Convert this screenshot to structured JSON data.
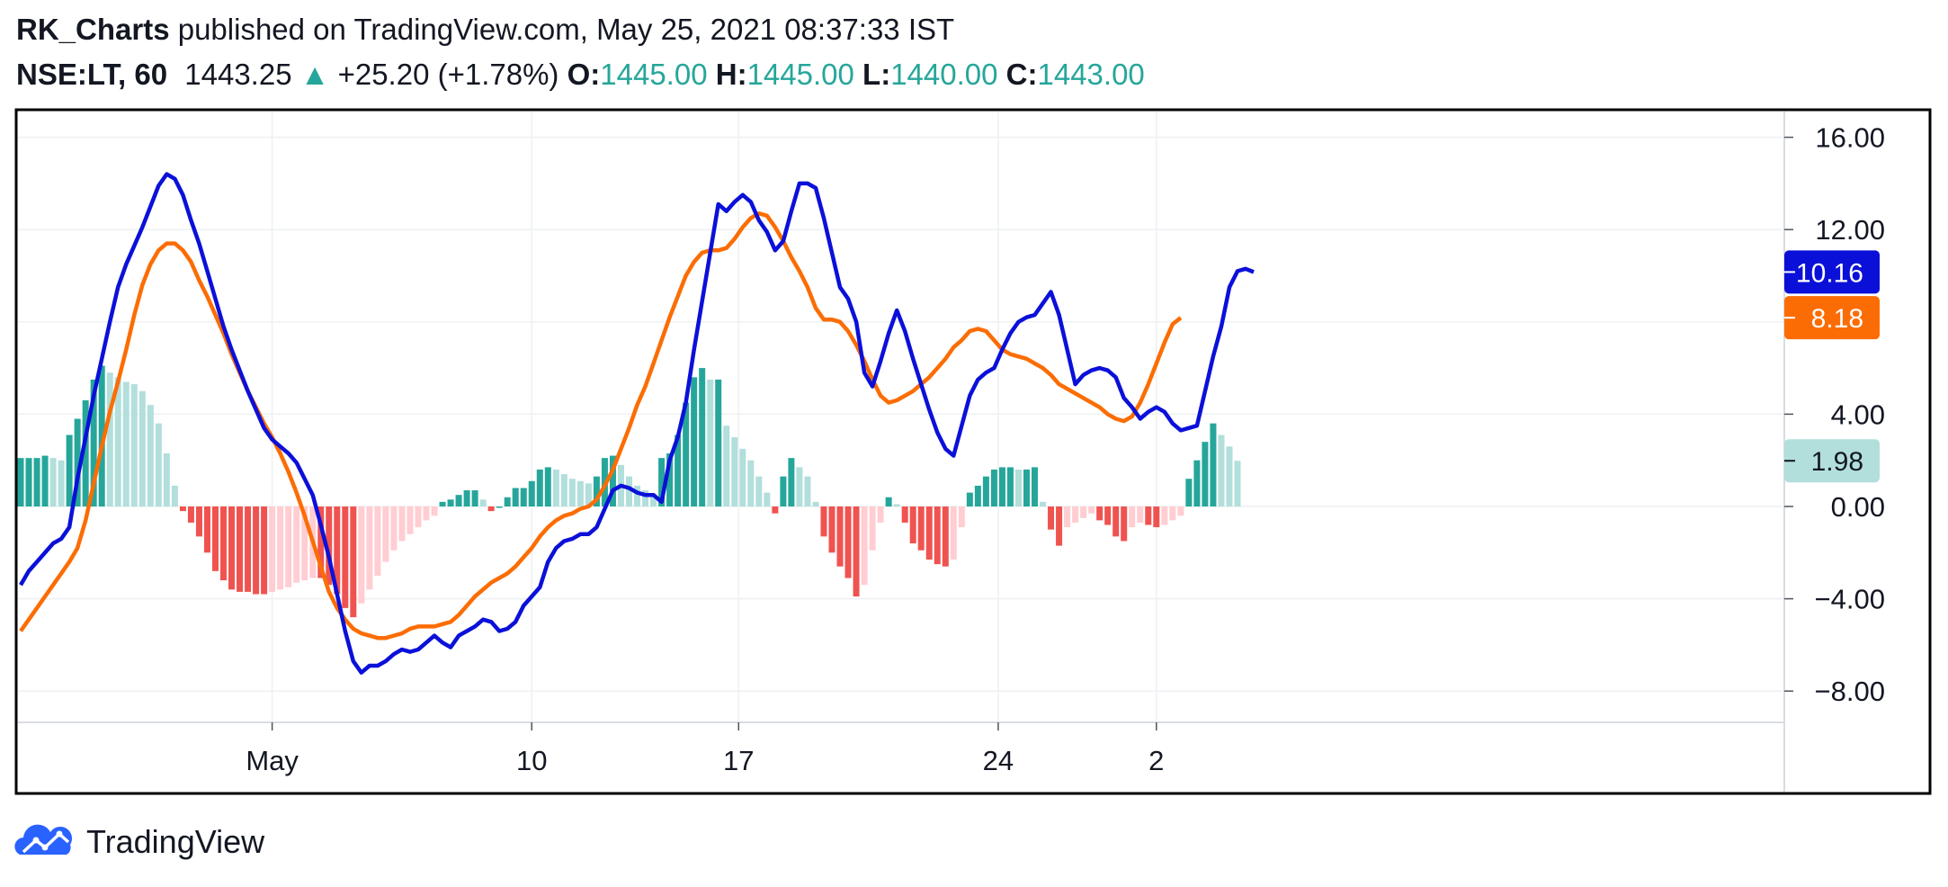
{
  "header": {
    "publisher": "RK_Charts",
    "published_text": "published on TradingView.com, May 25, 2021 08:37:33 IST",
    "symbol": "NSE:LT, 60",
    "last_price": "1443.25",
    "change": "+25.20 (+1.78%)",
    "open_label": "O:",
    "open": "1445.00",
    "high_label": "H:",
    "high": "1445.00",
    "low_label": "L:",
    "low": "1440.00",
    "close_label": "C:",
    "close": "1443.00",
    "up_arrow": "▲"
  },
  "footer": {
    "brand": "TradingView",
    "logo_icon": "tradingview-logo-icon"
  },
  "colors": {
    "macd": "#0b10d9",
    "signal": "#fb6d04",
    "hist_pos_strong": "#26a69a",
    "hist_pos_weak": "#b2dfdb",
    "hist_neg_strong": "#ef5350",
    "hist_neg_weak": "#ffcdd2",
    "up": "#26a69a"
  },
  "chart_data": {
    "type": "macd",
    "y_ticks": [
      "16.00",
      "12.00",
      "4.00",
      "0.00",
      "−4.00",
      "−8.00"
    ],
    "y_tick_values": [
      16,
      12,
      4,
      0,
      -4,
      -8
    ],
    "ylim": [
      -9.4,
      16.5
    ],
    "x_ticks": [
      "May",
      "10",
      "17",
      "24",
      "2"
    ],
    "x_tick_bar_index": [
      31,
      63,
      88.5,
      120.5,
      140
    ],
    "bar_count": 141,
    "grid": true,
    "last_values": {
      "macd": "10.16",
      "signal": "8.18",
      "histogram": "1.98"
    },
    "series": [
      {
        "name": "macd",
        "values": [
          -3.4,
          -2.8,
          -2.4,
          -2.0,
          -1.6,
          -1.4,
          -0.9,
          1.2,
          3.0,
          4.8,
          6.4,
          8.0,
          9.5,
          10.5,
          11.3,
          12.1,
          13.0,
          13.9,
          14.4,
          14.2,
          13.5,
          12.4,
          11.4,
          10.2,
          9.0,
          7.8,
          6.8,
          5.9,
          5.0,
          4.2,
          3.4,
          2.9,
          2.6,
          2.3,
          1.9,
          1.2,
          0.5,
          -0.8,
          -2.2,
          -3.8,
          -5.4,
          -6.7,
          -7.2,
          -6.9,
          -6.9,
          -6.7,
          -6.4,
          -6.2,
          -6.3,
          -6.2,
          -5.9,
          -5.6,
          -5.9,
          -6.1,
          -5.6,
          -5.4,
          -5.2,
          -4.9,
          -5.0,
          -5.4,
          -5.3,
          -5.0,
          -4.3,
          -3.9,
          -3.5,
          -2.4,
          -1.8,
          -1.5,
          -1.4,
          -1.2,
          -1.2,
          -0.9,
          -0.1,
          0.7,
          0.9,
          0.8,
          0.6,
          0.5,
          0.5,
          0.2,
          2.0,
          3.0,
          4.5,
          6.8,
          8.9,
          11.0,
          13.1,
          12.8,
          13.2,
          13.5,
          13.2,
          12.4,
          11.9,
          11.1,
          11.5,
          12.8,
          14.0,
          14.0,
          13.8,
          12.5,
          11.0,
          9.5,
          9.0,
          8.0,
          5.8,
          5.2,
          6.3,
          7.5,
          8.5,
          7.6,
          6.4,
          5.3,
          4.2,
          3.2,
          2.5,
          2.2,
          3.5,
          4.8,
          5.5,
          5.8,
          6.0,
          6.8,
          7.5,
          8.0,
          8.2,
          8.3,
          8.8,
          9.3,
          8.3,
          6.8,
          5.3,
          5.7,
          5.9,
          6.0,
          5.9,
          5.6,
          4.7,
          4.3,
          3.8,
          4.1,
          4.3,
          4.1,
          3.6,
          3.3,
          3.4,
          3.5,
          5.0,
          6.5,
          7.8,
          9.5,
          10.2,
          10.3,
          10.16
        ]
      },
      {
        "name": "signal",
        "values": [
          -5.4,
          -4.9,
          -4.4,
          -3.9,
          -3.4,
          -2.9,
          -2.4,
          -1.8,
          -0.6,
          1.0,
          2.6,
          4.1,
          5.4,
          6.8,
          8.3,
          9.6,
          10.5,
          11.1,
          11.4,
          11.4,
          11.1,
          10.6,
          9.8,
          9.1,
          8.3,
          7.5,
          6.6,
          5.8,
          5.0,
          4.3,
          3.6,
          3.0,
          2.3,
          1.5,
          0.6,
          -0.4,
          -1.5,
          -2.6,
          -3.7,
          -4.4,
          -4.9,
          -5.3,
          -5.5,
          -5.6,
          -5.7,
          -5.7,
          -5.6,
          -5.5,
          -5.3,
          -5.2,
          -5.2,
          -5.2,
          -5.1,
          -5.0,
          -4.7,
          -4.3,
          -3.9,
          -3.6,
          -3.3,
          -3.1,
          -2.9,
          -2.6,
          -2.2,
          -1.8,
          -1.3,
          -0.9,
          -0.6,
          -0.4,
          -0.3,
          -0.1,
          0.0,
          0.3,
          0.9,
          1.6,
          2.5,
          3.4,
          4.4,
          5.2,
          6.2,
          7.2,
          8.2,
          9.1,
          10.0,
          10.6,
          11.0,
          11.1,
          11.1,
          11.2,
          11.6,
          12.1,
          12.5,
          12.7,
          12.6,
          12.1,
          11.5,
          10.8,
          10.2,
          9.5,
          8.6,
          8.1,
          8.1,
          8.0,
          7.6,
          7.0,
          6.3,
          5.5,
          4.8,
          4.5,
          4.6,
          4.8,
          5.0,
          5.3,
          5.6,
          6.0,
          6.4,
          6.9,
          7.2,
          7.6,
          7.7,
          7.6,
          7.2,
          6.8,
          6.6,
          6.5,
          6.4,
          6.2,
          6.0,
          5.7,
          5.3,
          5.1,
          4.9,
          4.7,
          4.5,
          4.3,
          4.0,
          3.8,
          3.7,
          3.9,
          4.5,
          5.3,
          6.2,
          7.1,
          7.9,
          8.18
        ]
      },
      {
        "name": "histogram",
        "values": [
          2.1,
          2.1,
          2.1,
          2.2,
          2.1,
          2.0,
          3.1,
          3.8,
          4.6,
          5.5,
          6.1,
          5.8,
          5.6,
          5.4,
          5.3,
          5.0,
          4.4,
          3.6,
          2.3,
          0.9,
          -0.2,
          -0.7,
          -1.3,
          -2.0,
          -2.8,
          -3.2,
          -3.6,
          -3.7,
          -3.7,
          -3.8,
          -3.8,
          -3.7,
          -3.6,
          -3.5,
          -3.3,
          -3.2,
          -3.1,
          -3.1,
          -3.4,
          -3.8,
          -4.4,
          -4.8,
          -4.2,
          -3.6,
          -3.0,
          -2.4,
          -1.9,
          -1.5,
          -1.2,
          -0.9,
          -0.6,
          -0.4,
          0.2,
          0.3,
          0.5,
          0.7,
          0.7,
          0.3,
          -0.2,
          0.0,
          0.4,
          0.8,
          0.8,
          1.1,
          1.6,
          1.7,
          1.6,
          1.4,
          1.2,
          1.1,
          1.0,
          1.3,
          2.1,
          2.2,
          1.8,
          1.3,
          0.9,
          0.7,
          0.5,
          2.1,
          2.3,
          3.1,
          4.5,
          5.6,
          6.0,
          5.5,
          5.5,
          3.5,
          3.0,
          2.5,
          2.0,
          1.3,
          0.6,
          -0.3,
          1.3,
          2.1,
          1.7,
          1.3,
          0.2,
          -1.3,
          -2.0,
          -2.6,
          -3.1,
          -3.9,
          -3.4,
          -1.9,
          -0.7,
          0.4,
          0.1,
          -0.7,
          -1.6,
          -1.9,
          -2.3,
          -2.5,
          -2.6,
          -2.3,
          -0.9,
          0.6,
          0.9,
          1.3,
          1.6,
          1.7,
          1.7,
          1.6,
          1.6,
          1.7,
          0.2,
          -1.0,
          -1.7,
          -0.9,
          -0.7,
          -0.5,
          -0.3,
          -0.6,
          -0.8,
          -1.3,
          -1.5,
          -0.9,
          -0.7,
          -0.8,
          -0.9,
          -0.8,
          -0.6,
          -0.4,
          1.2,
          2.0,
          2.8,
          3.6,
          3.1,
          2.6,
          1.98
        ]
      }
    ]
  }
}
